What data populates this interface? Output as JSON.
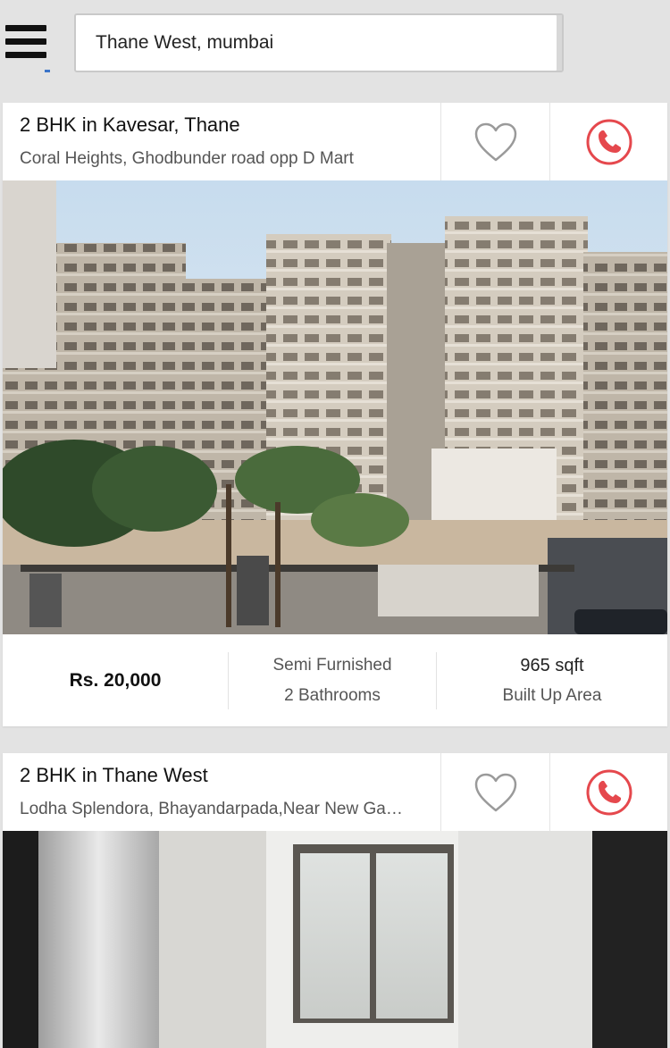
{
  "search": {
    "value": "Thane West, mumbai"
  },
  "listings": [
    {
      "title": "2 BHK in Kavesar, Thane",
      "subtitle": "Coral Heights, Ghodbunder road opp D Mart",
      "price": "Rs. 20,000",
      "furnishing": "Semi Furnished",
      "bathrooms": "2 Bathrooms",
      "area": "965 sqft",
      "area_label": "Built Up Area"
    },
    {
      "title": "2 BHK in Thane West",
      "subtitle": "Lodha Splendora, Bhayandarpada,Near New Ga…"
    }
  ],
  "icons": {
    "menu": "hamburger-menu-icon",
    "favorite": "heart-outline-icon",
    "call": "phone-circle-icon"
  },
  "colors": {
    "accent_red": "#e5484d",
    "background": "#e3e3e3"
  }
}
